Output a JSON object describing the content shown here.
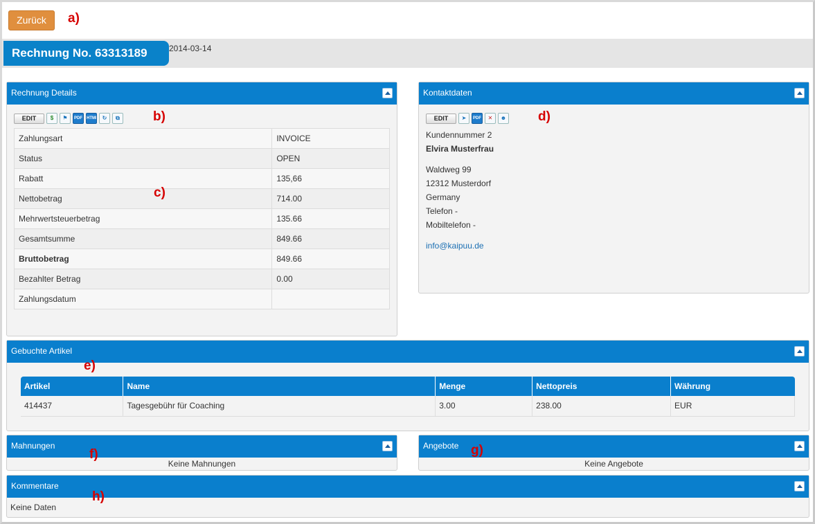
{
  "back_button": "Zurück",
  "annotations": [
    "a)",
    "b)",
    "c)",
    "d)",
    "e)",
    "f)",
    "g)",
    "h)"
  ],
  "invoice": {
    "title": "Rechnung No. 63313189",
    "date": "2014-03-14"
  },
  "details_panel": {
    "title": "Rechnung Details",
    "toolbar": {
      "edit": "EDIT",
      "icons": [
        "dollar-icon",
        "bell-icon",
        "pdf-icon",
        "html-icon",
        "refresh-icon",
        "copy-icon"
      ],
      "pdf": "PDF",
      "html": "HTML"
    },
    "rows": [
      {
        "label": "Zahlungsart",
        "value": "INVOICE"
      },
      {
        "label": "Status",
        "value": "OPEN"
      },
      {
        "label": "Rabatt",
        "value": "135,66"
      },
      {
        "label": "Nettobetrag",
        "value": "714.00"
      },
      {
        "label": "Mehrwertsteuerbetrag",
        "value": "135.66"
      },
      {
        "label": "Gesamtsumme",
        "value": "849.66"
      },
      {
        "label": "Bruttobetrag",
        "value": "849.66"
      },
      {
        "label": "Bezahlter Betrag",
        "value": "0.00"
      },
      {
        "label": "Zahlungsdatum",
        "value": ""
      }
    ]
  },
  "contact_panel": {
    "title": "Kontaktdaten",
    "toolbar": {
      "edit": "EDIT",
      "pdf": "PDF",
      "icons": [
        "send-icon",
        "pdf-icon",
        "delete-icon",
        "user-icon"
      ]
    },
    "customer_number": "Kundennummer 2",
    "name": "Elvira Musterfrau",
    "street": "Waldweg 99",
    "city": "12312 Musterdorf",
    "country": "Germany",
    "phone": "Telefon -",
    "mobile": "Mobiltelefon -",
    "email": "info@kaipuu.de"
  },
  "articles_panel": {
    "title": "Gebuchte Artikel",
    "columns": [
      "Artikel",
      "Name",
      "Menge",
      "Nettopreis",
      "Währung"
    ],
    "rows": [
      [
        "414437",
        "Tagesgebühr für Coaching",
        "3.00",
        "238.00",
        "EUR"
      ]
    ]
  },
  "reminders_panel": {
    "title": "Mahnungen",
    "empty": "Keine Mahnungen"
  },
  "offers_panel": {
    "title": "Angebote",
    "empty": "Keine Angebote"
  },
  "comments_panel": {
    "title": "Kommentare",
    "empty": "Keine Daten"
  },
  "colors": {
    "accent": "#0a7fcd",
    "back_button": "#e08f3e",
    "annotation": "#d60000"
  }
}
